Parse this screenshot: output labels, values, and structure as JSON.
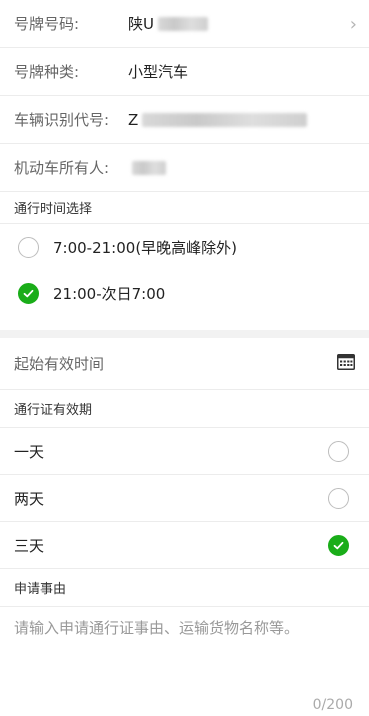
{
  "vehicle": {
    "plate_label": "号牌号码:",
    "plate_value": "陕U",
    "plate_type_label": "号牌种类:",
    "plate_type_value": "小型汽车",
    "vin_label": "车辆识别代号:",
    "vin_value": "Z",
    "owner_label": "机动车所有人:"
  },
  "time_section": {
    "title": "通行时间选择",
    "options": [
      {
        "label": "7:00-21:00(早晚高峰除外)",
        "checked": false
      },
      {
        "label": "21:00-次日7:00",
        "checked": true
      }
    ]
  },
  "start_time": {
    "label": "起始有效时间",
    "icon": "calendar-icon"
  },
  "validity_section": {
    "title": "通行证有效期",
    "options": [
      {
        "label": "一天",
        "checked": false
      },
      {
        "label": "两天",
        "checked": false
      },
      {
        "label": "三天",
        "checked": true
      }
    ]
  },
  "reason_section": {
    "title": "申请事由",
    "placeholder": "请输入申请通行证事由、运输货物名称等。",
    "counter": "0/200"
  },
  "colors": {
    "accent": "#1aad19",
    "background": "#f2f2f2"
  }
}
